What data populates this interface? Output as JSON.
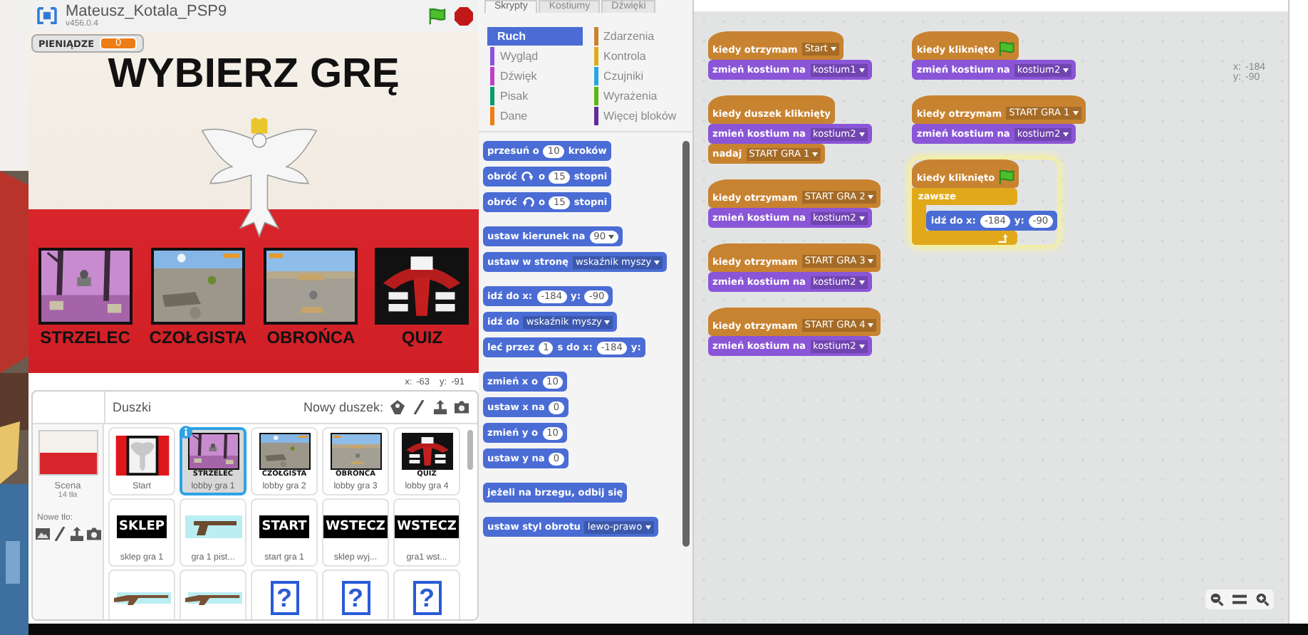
{
  "header": {
    "project_title": "Mateusz_Kotala_PSP9",
    "version": "v456.0.4"
  },
  "stage": {
    "title": "WYBIERZ GRĘ",
    "monitor": {
      "label": "PIENIĄDZE",
      "value": "0"
    },
    "games": [
      {
        "label": "STRZELEC",
        "kind": "forest"
      },
      {
        "label": "CZOŁGISTA",
        "kind": "gravel"
      },
      {
        "label": "OBROŃCA",
        "kind": "desert"
      },
      {
        "label": "QUIZ",
        "kind": "quiz"
      }
    ],
    "mouse_position": [
      {
        "label": "x:",
        "value": "-63"
      },
      {
        "label": "y:",
        "value": "-91"
      }
    ]
  },
  "sprites": {
    "title": "Duszki",
    "new_sprite_label": "Nowy duszek:",
    "scene": {
      "label": "Scena",
      "count": "14 tła",
      "new_backdrop_label": "Nowe tło:"
    },
    "items": [
      {
        "name": "Start",
        "selected": false,
        "kind": "eagle"
      },
      {
        "name": "lobby gra 1",
        "selected": true,
        "kind": "forest",
        "caption": "STRZELEC"
      },
      {
        "name": "lobby gra 2",
        "selected": false,
        "kind": "gravel",
        "caption": "CZOŁGISTA"
      },
      {
        "name": "lobby gra 3",
        "selected": false,
        "kind": "desert",
        "caption": "OBROŃCA"
      },
      {
        "name": "lobby gra 4",
        "selected": false,
        "kind": "quiz",
        "caption": "QUIZ"
      },
      {
        "name": "sklep gra 1",
        "selected": false,
        "kind": "button",
        "caption": "SKLEP"
      },
      {
        "name": "gra 1 pist...",
        "selected": false,
        "kind": "pistol"
      },
      {
        "name": "start gra 1",
        "selected": false,
        "kind": "button",
        "caption": "START"
      },
      {
        "name": "sklep wyj...",
        "selected": false,
        "kind": "button",
        "caption": "WSTECZ"
      },
      {
        "name": "gra1 wst...",
        "selected": false,
        "kind": "button",
        "caption": "WSTECZ"
      },
      {
        "selected": false,
        "kind": "rifle"
      },
      {
        "selected": false,
        "kind": "rifle"
      },
      {
        "selected": false,
        "kind": "question",
        "caption": "?"
      },
      {
        "selected": false,
        "kind": "question",
        "caption": "?"
      },
      {
        "selected": false,
        "kind": "question",
        "caption": "?"
      }
    ]
  },
  "tabs": [
    {
      "label": "Skrypty",
      "selected": true
    },
    {
      "label": "Kostiumy",
      "selected": false
    },
    {
      "label": "Dźwięki",
      "selected": false
    }
  ],
  "categories": [
    {
      "label": "Ruch",
      "color": "#4a6cd4",
      "selected": true
    },
    {
      "label": "Zdarzenia",
      "color": "#c88330",
      "selected": false
    },
    {
      "label": "Wygląd",
      "color": "#8a55d7",
      "selected": false
    },
    {
      "label": "Kontrola",
      "color": "#e1a91a",
      "selected": false
    },
    {
      "label": "Dźwięk",
      "color": "#bb42c3",
      "selected": false
    },
    {
      "label": "Czujniki",
      "color": "#2ca5e2",
      "selected": false
    },
    {
      "label": "Pisak",
      "color": "#0e9a6c",
      "selected": false
    },
    {
      "label": "Wyrażenia",
      "color": "#5cb712",
      "selected": false
    },
    {
      "label": "Dane",
      "color": "#ee7d16",
      "selected": false
    },
    {
      "label": "Więcej bloków",
      "color": "#632d99",
      "selected": false
    }
  ],
  "palette": {
    "groups": [
      [
        {
          "kind": "stack",
          "color": "#4a6cd4",
          "parts": [
            {
              "kind": "text",
              "text": "przesuń o"
            },
            {
              "kind": "number",
              "text": "10"
            },
            {
              "kind": "text",
              "text": "kroków"
            }
          ]
        },
        {
          "kind": "stack",
          "color": "#4a6cd4",
          "parts": [
            {
              "kind": "text",
              "text": "obróć"
            },
            {
              "kind": "turn_right"
            },
            {
              "kind": "text",
              "text": "o"
            },
            {
              "kind": "number",
              "text": "15"
            },
            {
              "kind": "text",
              "text": "stopni"
            }
          ]
        },
        {
          "kind": "stack",
          "color": "#4a6cd4",
          "parts": [
            {
              "kind": "text",
              "text": "obróć"
            },
            {
              "kind": "turn_left"
            },
            {
              "kind": "text",
              "text": "o"
            },
            {
              "kind": "number",
              "text": "15"
            },
            {
              "kind": "text",
              "text": "stopni"
            }
          ]
        }
      ],
      [
        {
          "kind": "stack",
          "color": "#4a6cd4",
          "parts": [
            {
              "kind": "text",
              "text": "ustaw kierunek na"
            },
            {
              "kind": "number_menu",
              "text": "90"
            }
          ]
        },
        {
          "kind": "stack",
          "color": "#4a6cd4",
          "parts": [
            {
              "kind": "text",
              "text": "ustaw w stronę"
            },
            {
              "kind": "dropdown",
              "text": "wskaźnik myszy"
            }
          ]
        }
      ],
      [
        {
          "kind": "stack",
          "color": "#4a6cd4",
          "parts": [
            {
              "kind": "text",
              "text": "idź do x:"
            },
            {
              "kind": "number",
              "text": "-184"
            },
            {
              "kind": "text",
              "text": "y:"
            },
            {
              "kind": "number",
              "text": "-90"
            }
          ]
        },
        {
          "kind": "stack",
          "color": "#4a6cd4",
          "parts": [
            {
              "kind": "text",
              "text": "idź do"
            },
            {
              "kind": "dropdown",
              "text": "wskaźnik myszy"
            }
          ]
        },
        {
          "kind": "stack",
          "color": "#4a6cd4",
          "parts": [
            {
              "kind": "text",
              "text": "leć przez"
            },
            {
              "kind": "number",
              "text": "1"
            },
            {
              "kind": "text",
              "text": "s do x:"
            },
            {
              "kind": "number",
              "text": "-184"
            },
            {
              "kind": "text",
              "text": "y:"
            }
          ]
        }
      ],
      [
        {
          "kind": "stack",
          "color": "#4a6cd4",
          "parts": [
            {
              "kind": "text",
              "text": "zmień x o"
            },
            {
              "kind": "number",
              "text": "10"
            }
          ]
        },
        {
          "kind": "stack",
          "color": "#4a6cd4",
          "parts": [
            {
              "kind": "text",
              "text": "ustaw x na"
            },
            {
              "kind": "number",
              "text": "0"
            }
          ]
        },
        {
          "kind": "stack",
          "color": "#4a6cd4",
          "parts": [
            {
              "kind": "text",
              "text": "zmień y o"
            },
            {
              "kind": "number",
              "text": "10"
            }
          ]
        },
        {
          "kind": "stack",
          "color": "#4a6cd4",
          "parts": [
            {
              "kind": "text",
              "text": "ustaw y na"
            },
            {
              "kind": "number",
              "text": "0"
            }
          ]
        }
      ],
      [
        {
          "kind": "stack",
          "color": "#4a6cd4",
          "parts": [
            {
              "kind": "text",
              "text": "jeżeli na brzegu, odbij się"
            }
          ]
        }
      ],
      [
        {
          "kind": "stack",
          "color": "#4a6cd4",
          "parts": [
            {
              "kind": "text",
              "text": "ustaw styl obrotu"
            },
            {
              "kind": "dropdown",
              "text": "lewo-prawo"
            }
          ]
        }
      ]
    ]
  },
  "scripts": {
    "sprite_position": [
      {
        "label": "x:",
        "value": "-184"
      },
      {
        "label": "y:",
        "value": "-90"
      }
    ],
    "columns": [
      [
        {
          "running": false,
          "blocks": [
            {
              "kind": "hat",
              "color": "#c88330",
              "parts": [
                {
                  "kind": "text",
                  "text": "kiedy otrzymam"
                },
                {
                  "kind": "dropdown",
                  "text": "Start"
                }
              ]
            },
            {
              "kind": "stack",
              "color": "#8a55d7",
              "parts": [
                {
                  "kind": "text",
                  "text": "zmień kostium na"
                },
                {
                  "kind": "dropdown",
                  "text": "kostium1"
                }
              ]
            }
          ]
        },
        {
          "running": false,
          "blocks": [
            {
              "kind": "hat",
              "color": "#c88330",
              "parts": [
                {
                  "kind": "text",
                  "text": "kiedy duszek kliknięty"
                }
              ]
            },
            {
              "kind": "stack",
              "color": "#8a55d7",
              "parts": [
                {
                  "kind": "text",
                  "text": "zmień kostium na"
                },
                {
                  "kind": "dropdown",
                  "text": "kostium2"
                }
              ]
            },
            {
              "kind": "stack",
              "color": "#c88330",
              "parts": [
                {
                  "kind": "text",
                  "text": "nadaj"
                },
                {
                  "kind": "dropdown",
                  "text": "START GRA 1"
                }
              ]
            }
          ]
        },
        {
          "running": false,
          "blocks": [
            {
              "kind": "hat",
              "color": "#c88330",
              "parts": [
                {
                  "kind": "text",
                  "text": "kiedy otrzymam"
                },
                {
                  "kind": "dropdown",
                  "text": "START GRA 2"
                }
              ]
            },
            {
              "kind": "stack",
              "color": "#8a55d7",
              "parts": [
                {
                  "kind": "text",
                  "text": "zmień kostium na"
                },
                {
                  "kind": "dropdown",
                  "text": "kostium2"
                }
              ]
            }
          ]
        },
        {
          "running": false,
          "blocks": [
            {
              "kind": "hat",
              "color": "#c88330",
              "parts": [
                {
                  "kind": "text",
                  "text": "kiedy otrzymam"
                },
                {
                  "kind": "dropdown",
                  "text": "START GRA 3"
                }
              ]
            },
            {
              "kind": "stack",
              "color": "#8a55d7",
              "parts": [
                {
                  "kind": "text",
                  "text": "zmień kostium na"
                },
                {
                  "kind": "dropdown",
                  "text": "kostium2"
                }
              ]
            }
          ]
        },
        {
          "running": false,
          "blocks": [
            {
              "kind": "hat",
              "color": "#c88330",
              "parts": [
                {
                  "kind": "text",
                  "text": "kiedy otrzymam"
                },
                {
                  "kind": "dropdown",
                  "text": "START GRA 4"
                }
              ]
            },
            {
              "kind": "stack",
              "color": "#8a55d7",
              "parts": [
                {
                  "kind": "text",
                  "text": "zmień kostium na"
                },
                {
                  "kind": "dropdown",
                  "text": "kostium2"
                }
              ]
            }
          ]
        }
      ],
      [
        {
          "running": false,
          "blocks": [
            {
              "kind": "hat",
              "color": "#c88330",
              "parts": [
                {
                  "kind": "text",
                  "text": "kiedy kliknięto"
                },
                {
                  "kind": "flag"
                }
              ]
            },
            {
              "kind": "stack",
              "color": "#8a55d7",
              "parts": [
                {
                  "kind": "text",
                  "text": "zmień kostium na"
                },
                {
                  "kind": "dropdown",
                  "text": "kostium2"
                }
              ]
            }
          ]
        },
        {
          "running": false,
          "blocks": [
            {
              "kind": "hat",
              "color": "#c88330",
              "parts": [
                {
                  "kind": "text",
                  "text": "kiedy otrzymam"
                },
                {
                  "kind": "dropdown",
                  "text": "START GRA 1"
                }
              ]
            },
            {
              "kind": "stack",
              "color": "#8a55d7",
              "parts": [
                {
                  "kind": "text",
                  "text": "zmień kostium na"
                },
                {
                  "kind": "dropdown",
                  "text": "kostium2"
                }
              ]
            }
          ]
        },
        {
          "running": true,
          "blocks": [
            {
              "kind": "hat",
              "color": "#c88330",
              "parts": [
                {
                  "kind": "text",
                  "text": "kiedy kliknięto"
                },
                {
                  "kind": "flag"
                }
              ]
            },
            {
              "kind": "c",
              "color": "#e1a91a",
              "parts": [
                {
                  "kind": "text",
                  "text": "zawsze"
                }
              ],
              "children": [
                {
                  "kind": "stack",
                  "color": "#4a6cd4",
                  "parts": [
                    {
                      "kind": "text",
                      "text": "idź do x:"
                    },
                    {
                      "kind": "number",
                      "text": "-184"
                    },
                    {
                      "kind": "text",
                      "text": "y:"
                    },
                    {
                      "kind": "number",
                      "text": "-90"
                    }
                  ]
                }
              ]
            }
          ]
        }
      ]
    ]
  }
}
